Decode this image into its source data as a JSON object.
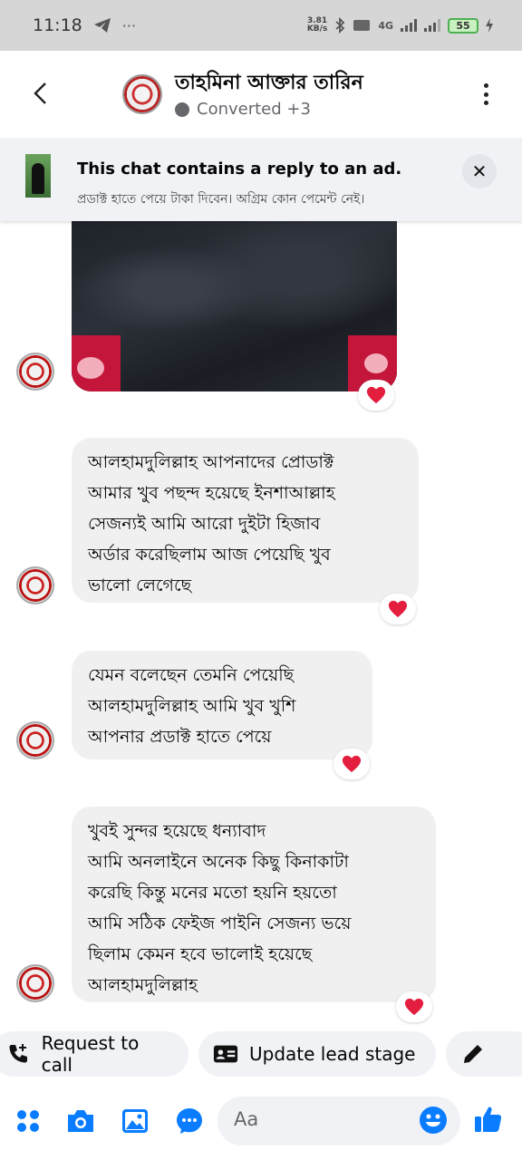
{
  "status_bar": {
    "time": "11:18",
    "speed": "3.81\nKB/s",
    "network": "4G",
    "battery": "55"
  },
  "header": {
    "contact_name": "তাহমিনা আক্তার তারিন",
    "subtitle": "Converted +3"
  },
  "ad_banner": {
    "title": "This chat contains a reply to an ad.",
    "text": "প্রডাক্ট হাতে পেয়ে টাকা দিবেন। অগ্রিম কোন পেমেন্ট নেই।"
  },
  "messages": [
    {
      "type": "image",
      "reaction": "heart"
    },
    {
      "type": "text",
      "text": "আলহামদুলিল্লাহ আপনাদের প্রোডাক্ট\nআমার খুব পছন্দ হয়েছে ইনশাআল্লাহ\nসেজন্যই আমি  আরো দুইটা হিজাব\nঅর্ডার  করেছিলাম আজ পেয়েছি খুব\nভালো লেগেছে",
      "reaction": "heart"
    },
    {
      "type": "text",
      "text": "যেমন বলেছেন তেমনি পেয়েছি\nআলহামদুলিল্লাহ আমি খুব খুশি\nআপনার প্রডাক্ট হাতে পেয়ে",
      "reaction": "heart"
    },
    {
      "type": "text",
      "text": "খুবই সুন্দর হয়েছে ধন্যাবাদ\nআমি অনলাইনে অনেক কিছু কিনাকাটা\nকরেছি কিন্তু মনের মতো হয়নি হয়তো\nআমি সঠিক ফেইজ পাইনি সেজন্য ভয়ে\nছিলাম কেমন হবে  ভালোই হয়েছে\nআলহামদুলিল্লাহ",
      "reaction": "heart"
    }
  ],
  "actions": {
    "request_call": "Request to call",
    "update_lead": "Update lead stage"
  },
  "composer": {
    "placeholder": "Aa"
  },
  "colors": {
    "accent": "#0a7cff",
    "heart": "#e41e3f",
    "bubble": "#f0f0f0",
    "status_bar": "#d6d6d6"
  }
}
